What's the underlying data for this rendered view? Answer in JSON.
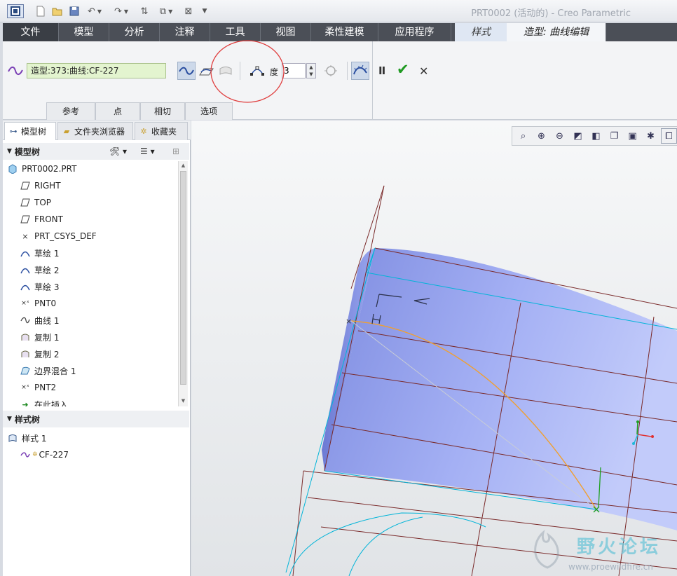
{
  "window": {
    "title": "PRT0002 (活动的) - Creo Parametric",
    "app_button_icon": "creo-app-icon",
    "quick_access_icons": [
      "new-icon",
      "open-icon",
      "save-icon",
      "undo-icon",
      "redo-icon",
      "regenerate-icon",
      "window-icon",
      "close-window-icon",
      "customize-icon"
    ]
  },
  "ribbon_tabs": [
    "文件",
    "模型",
    "分析",
    "注释",
    "工具",
    "视图",
    "柔性建模",
    "应用程序",
    "样式",
    "造型: 曲线编辑"
  ],
  "ribbon": {
    "curve_name": "造型:373:曲线:CF-227",
    "degree_label": "度",
    "degree_value": "3",
    "subtabs": [
      "参考",
      "点",
      "相切",
      "选项"
    ],
    "pause_label": "II",
    "ok_label": "✔",
    "cancel_label": "✕"
  },
  "navigator": {
    "tabs": [
      "模型树",
      "文件夹浏览器",
      "收藏夹"
    ],
    "model_tree_header": "模型树",
    "items": [
      "PRT0002.PRT",
      "RIGHT",
      "TOP",
      "FRONT",
      "PRT_CSYS_DEF",
      "草绘 1",
      "草绘 2",
      "草绘 3",
      "PNT0",
      "曲线 1",
      "复制 1",
      "复制 2",
      "边界混合 1",
      "PNT2",
      "在此插入"
    ],
    "style_tree_header": "样式树",
    "style_items": [
      "样式 1",
      "CF-227"
    ]
  },
  "watermark": {
    "text": "野火论坛",
    "url": "www.proewildfire.cn"
  },
  "colors": {
    "surface": "#9aa6f0",
    "curve": "#f0a030",
    "datum": "#7a2a2a",
    "boundary": "#00b4d8",
    "active_field": "#e3f4cf",
    "annotation_circle": "#e04040"
  }
}
